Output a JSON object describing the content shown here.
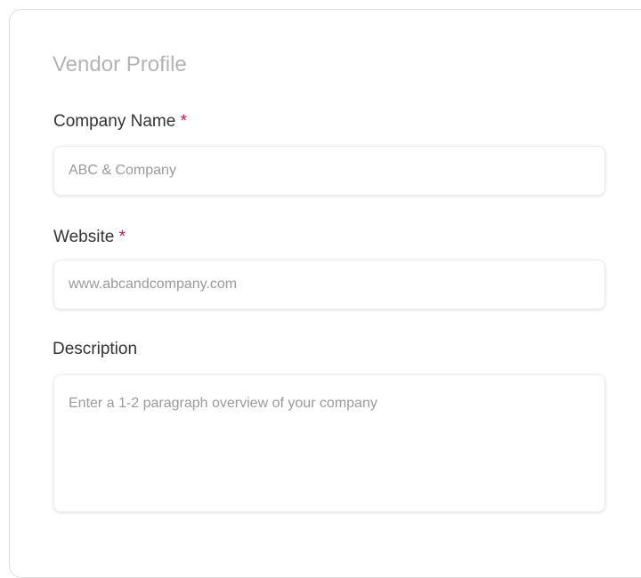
{
  "form": {
    "title": "Vendor Profile",
    "required_marker": "*",
    "company_name": {
      "label": "Company Name",
      "placeholder": "ABC & Company",
      "value": ""
    },
    "website": {
      "label": "Website",
      "placeholder": "www.abcandcompany.com",
      "value": ""
    },
    "description": {
      "label": "Description",
      "placeholder": "Enter a 1-2 paragraph overview of your company",
      "value": ""
    }
  },
  "colors": {
    "required": "#c2185b",
    "title": "#b3b3b3",
    "label": "#333333",
    "placeholder": "#9a9a9a",
    "card_border": "#dcdcdc"
  }
}
